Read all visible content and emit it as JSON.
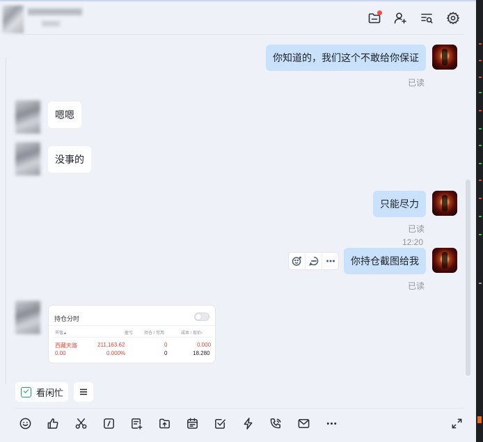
{
  "messages": {
    "m1": {
      "text": "你知道的，我们这个不敢给你保证",
      "status": "已读"
    },
    "m2": {
      "text": "嗯嗯"
    },
    "m3": {
      "text": "没事的"
    },
    "m4": {
      "text": "只能尽力",
      "status": "已读"
    },
    "divider_time": "12:20",
    "m5": {
      "text": "你持仓截图给我",
      "status": "已读"
    }
  },
  "screenshot_card": {
    "title": "持仓分时",
    "headers": [
      "市值",
      "盈亏",
      "持仓 / 可用",
      "成本 / 现价"
    ],
    "row_name": "西藏天路",
    "row_market_value": "211,163.62",
    "row_position": "0",
    "row_cost": "0.000",
    "row2_value": "0.00",
    "row2_pct": "0.000%",
    "row2_available": "0",
    "row2_price": "18.280"
  },
  "quick_actions": {
    "busy_label": "看闲忙"
  },
  "colors": {
    "my_bubble": "#c9e1fb",
    "accent_green": "#1aa35c",
    "badge_red": "#f54a45"
  },
  "icons": {
    "header": [
      "folder-icon",
      "add-user-icon",
      "search-list-icon",
      "gear-icon"
    ],
    "message_actions": [
      "add-reaction-icon",
      "reply-icon",
      "more-icon"
    ],
    "toolbar": [
      "emoji-icon",
      "thumbs-up-icon",
      "scissors-icon",
      "slash-command-icon",
      "add-doc-icon",
      "upload-icon",
      "calendar-icon",
      "task-check-icon",
      "lightning-icon",
      "call-icon",
      "mail-icon",
      "more-icon",
      "expand-icon"
    ]
  }
}
